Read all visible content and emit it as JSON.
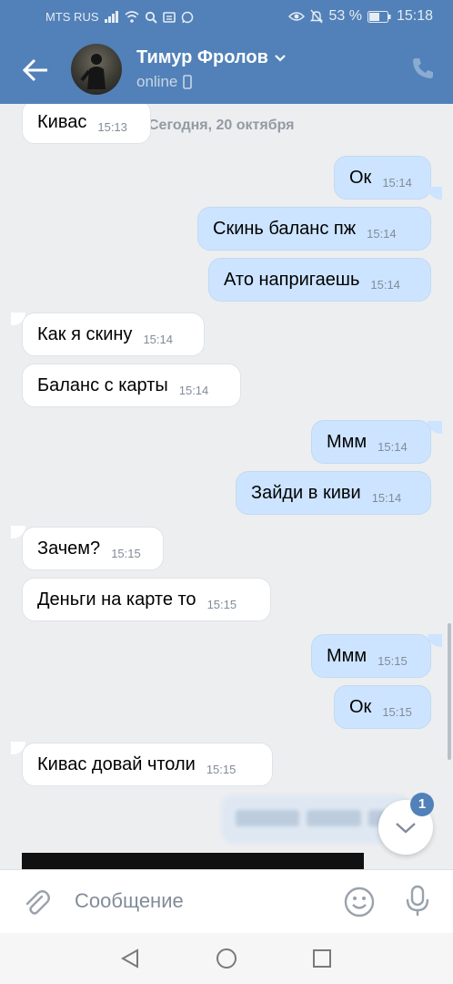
{
  "status_bar": {
    "carrier": "MTS RUS",
    "battery": "53 %",
    "time": "15:18"
  },
  "header": {
    "contact_name": "Тимур Фролов",
    "status": "online"
  },
  "chat": {
    "date_separator": "Сегодня, 20 октября",
    "messages": [
      {
        "dir": "in",
        "text": "Кивас",
        "time": "15:13"
      },
      {
        "dir": "out",
        "text": "Ок",
        "time": "15:14"
      },
      {
        "dir": "out",
        "text": "Скинь баланс пж",
        "time": "15:14"
      },
      {
        "dir": "out",
        "text": "Ато напригаешь",
        "time": "15:14"
      },
      {
        "dir": "in",
        "text": "Как я скину",
        "time": "15:14"
      },
      {
        "dir": "in",
        "text": "Баланс с карты",
        "time": "15:14"
      },
      {
        "dir": "out",
        "text": "Ммм",
        "time": "15:14"
      },
      {
        "dir": "out",
        "text": "Зайди в киви",
        "time": "15:14"
      },
      {
        "dir": "in",
        "text": "Зачем?",
        "time": "15:15"
      },
      {
        "dir": "in",
        "text": "Деньги на карте то",
        "time": "15:15"
      },
      {
        "dir": "out",
        "text": "Ммм",
        "time": "15:15"
      },
      {
        "dir": "out",
        "text": "Ок",
        "time": "15:15"
      },
      {
        "dir": "in",
        "text": "Кивас довай чтоли",
        "time": "15:15"
      }
    ],
    "unread_count": "1"
  },
  "composer": {
    "placeholder": "Сообщение"
  },
  "icons": {
    "back": "arrow-left-icon",
    "phone": "phone-icon",
    "attach": "paperclip-icon",
    "emoji": "smiley-icon",
    "mic": "microphone-icon",
    "scroll": "chevron-down-icon"
  },
  "colors": {
    "header": "#5181b8",
    "outgoing_bubble": "#cce4ff",
    "incoming_bubble": "#ffffff",
    "background": "#edeef0"
  }
}
